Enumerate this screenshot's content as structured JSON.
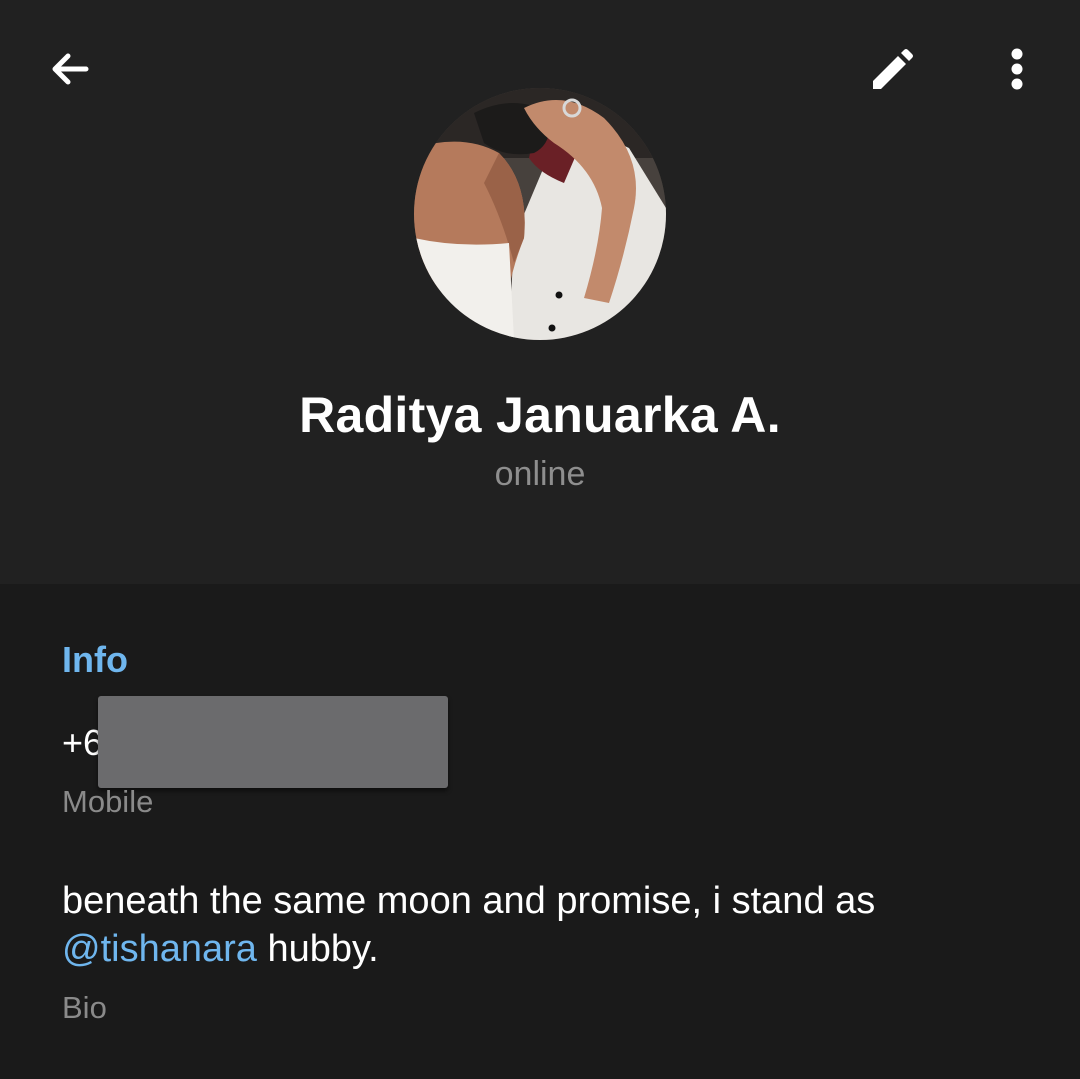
{
  "toolbar": {
    "back_icon": "arrow-left-icon",
    "edit_icon": "pencil-icon",
    "menu_icon": "more-vertical-icon"
  },
  "profile": {
    "name": "Raditya Januarka A.",
    "status": "online",
    "avatar": "profile-photo"
  },
  "info": {
    "title": "Info",
    "phone": {
      "value": "+6",
      "label": "Mobile"
    },
    "bio": {
      "text_before": "beneath the same moon and promise, i stand as ",
      "mention": "@tishanara",
      "text_after": " hubby.",
      "label": "Bio"
    }
  },
  "colors": {
    "header_bg": "#212121",
    "page_bg": "#1a1a1a",
    "accent": "#6fb6ee",
    "secondary_text": "#8e8e8e"
  }
}
